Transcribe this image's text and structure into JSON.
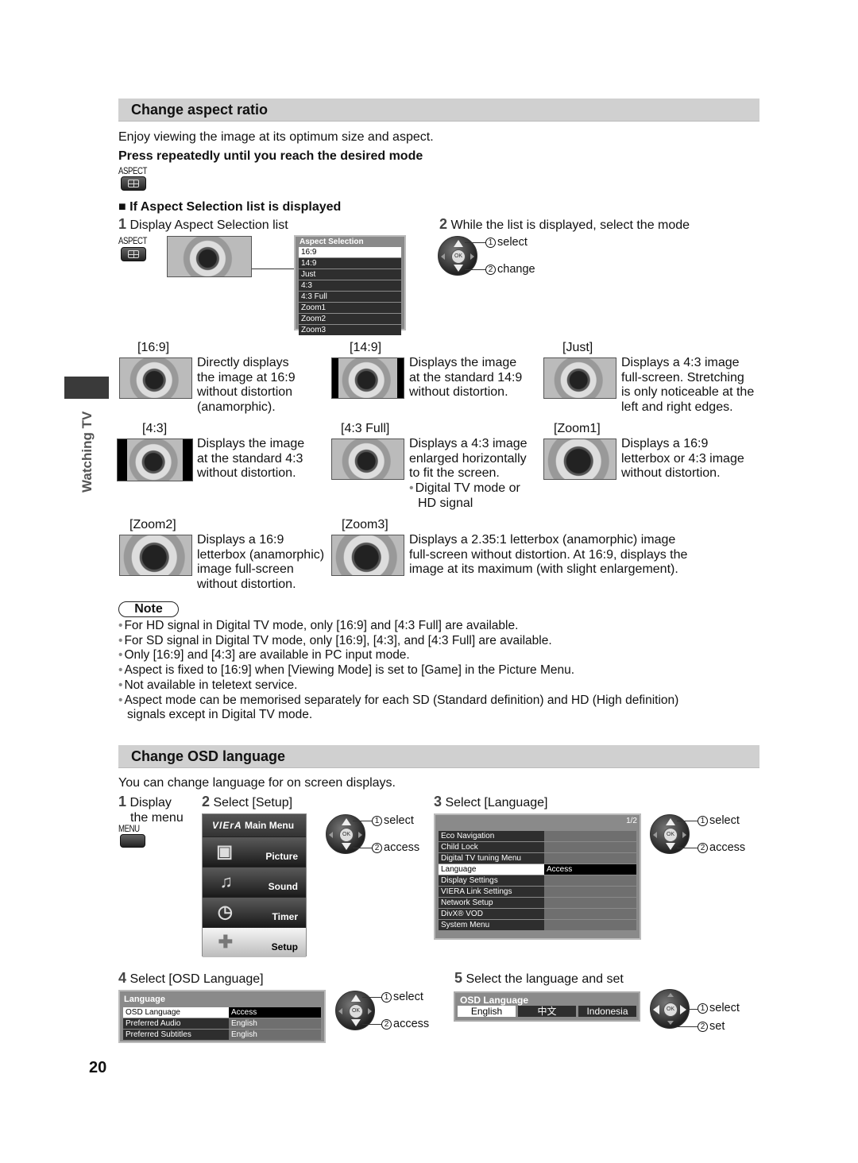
{
  "page_number": "20",
  "side_tab": {
    "label": "Watching TV"
  },
  "aspect": {
    "title": "Change aspect ratio",
    "intro": "Enjoy viewing the image at its optimum size and aspect.",
    "press_instruction": "Press repeatedly until you reach the desired mode",
    "aspect_key_label": "ASPECT",
    "list_heading": "If Aspect Selection list is displayed",
    "step1": {
      "num": "1",
      "text": "Display Aspect Selection list"
    },
    "step2": {
      "num": "2",
      "text": "While the list is displayed, select the mode"
    },
    "select_label": "select",
    "change_label": "change",
    "circle1": "1",
    "circle2": "2",
    "ok_label": "OK",
    "selection_menu": {
      "title": "Aspect Selection",
      "items": [
        "16:9",
        "14:9",
        "Just",
        "4:3",
        "4:3 Full",
        "Zoom1",
        "Zoom2",
        "Zoom3"
      ],
      "selected": "16:9"
    },
    "modes": [
      {
        "label": "[16:9]",
        "desc": [
          "Directly displays",
          "the image at 16:9",
          "without distortion",
          "(anamorphic)."
        ]
      },
      {
        "label": "[14:9]",
        "desc": [
          "Displays the image",
          "at the standard 14:9",
          "without distortion."
        ]
      },
      {
        "label": "[Just]",
        "desc": [
          "Displays a 4:3 image",
          "full-screen. Stretching",
          "is only noticeable at the",
          "left and right edges."
        ]
      },
      {
        "label": "[4:3]",
        "desc": [
          "Displays the image",
          "at the standard 4:3",
          "without distortion."
        ]
      },
      {
        "label": "[4:3 Full]",
        "desc": [
          "Displays a 4:3 image",
          "enlarged horizontally",
          "to fit the screen."
        ],
        "bullet": [
          "Digital TV mode or",
          "HD signal"
        ]
      },
      {
        "label": "[Zoom1]",
        "desc": [
          "Displays a 16:9",
          "letterbox or 4:3 image",
          "without distortion."
        ]
      },
      {
        "label": "[Zoom2]",
        "desc": [
          "Displays a 16:9",
          "letterbox (anamorphic)",
          "image full-screen",
          "without distortion."
        ]
      },
      {
        "label": "[Zoom3]",
        "desc": [
          "Displays a 2.35:1 letterbox (anamorphic) image",
          "full-screen without distortion. At 16:9, displays the",
          "image at its maximum (with slight enlargement)."
        ]
      }
    ],
    "note_label": "Note",
    "notes": [
      "For HD signal in Digital TV mode, only [16:9] and [4:3 Full] are available.",
      "For SD signal in Digital TV mode, only [16:9], [4:3], and [4:3 Full] are available.",
      "Only [16:9] and [4:3] are available in PC input mode.",
      "Aspect is fixed to [16:9] when [Viewing Mode] is set to [Game] in the Picture Menu.",
      "Not available in teletext service.",
      "Aspect mode can be memorised separately for each SD (Standard definition) and HD (High definition)",
      "signals except in Digital TV mode."
    ]
  },
  "osd": {
    "title": "Change OSD language",
    "intro": "You can change language for on screen displays.",
    "menu_key_label": "MENU",
    "step1": {
      "num": "1",
      "line1": "Display",
      "line2": "the menu"
    },
    "step2": {
      "num": "2",
      "text": "Select [Setup]"
    },
    "step3": {
      "num": "3",
      "text": "Select [Language]"
    },
    "step4": {
      "num": "4",
      "text": "Select [OSD Language]"
    },
    "step5": {
      "num": "5",
      "text": "Select the language and set"
    },
    "select_label": "select",
    "access_label": "access",
    "set_label": "set",
    "main_menu": {
      "brand": "VIErA",
      "title": "Main Menu",
      "items": [
        {
          "label": "Picture",
          "icon": "picture-icon"
        },
        {
          "label": "Sound",
          "icon": "music-note-icon"
        },
        {
          "label": "Timer",
          "icon": "clock-icon"
        },
        {
          "label": "Setup",
          "icon": "wrench-icon",
          "selected": true
        }
      ]
    },
    "setup_menu": {
      "page": "1/2",
      "items": [
        {
          "label": "Eco Navigation",
          "value": ""
        },
        {
          "label": "Child Lock",
          "value": ""
        },
        {
          "label": "Digital TV tuning Menu",
          "value": ""
        },
        {
          "label": "Language",
          "value": "Access",
          "selected": true
        },
        {
          "label": "Display Settings",
          "value": ""
        },
        {
          "label": "VIERA Link Settings",
          "value": ""
        },
        {
          "label": "Network Setup",
          "value": ""
        },
        {
          "label": "DivX® VOD",
          "value": ""
        },
        {
          "label": "System Menu",
          "value": ""
        }
      ]
    },
    "language_menu": {
      "title": "Language",
      "items": [
        {
          "label": "OSD Language",
          "value": "Access",
          "selected": true
        },
        {
          "label": "Preferred Audio",
          "value": "English"
        },
        {
          "label": "Preferred Subtitles",
          "value": "English"
        }
      ]
    },
    "osd_language_menu": {
      "title": "OSD Language",
      "options": [
        "English",
        "中文",
        "Indonesia"
      ],
      "selected": "English"
    }
  }
}
